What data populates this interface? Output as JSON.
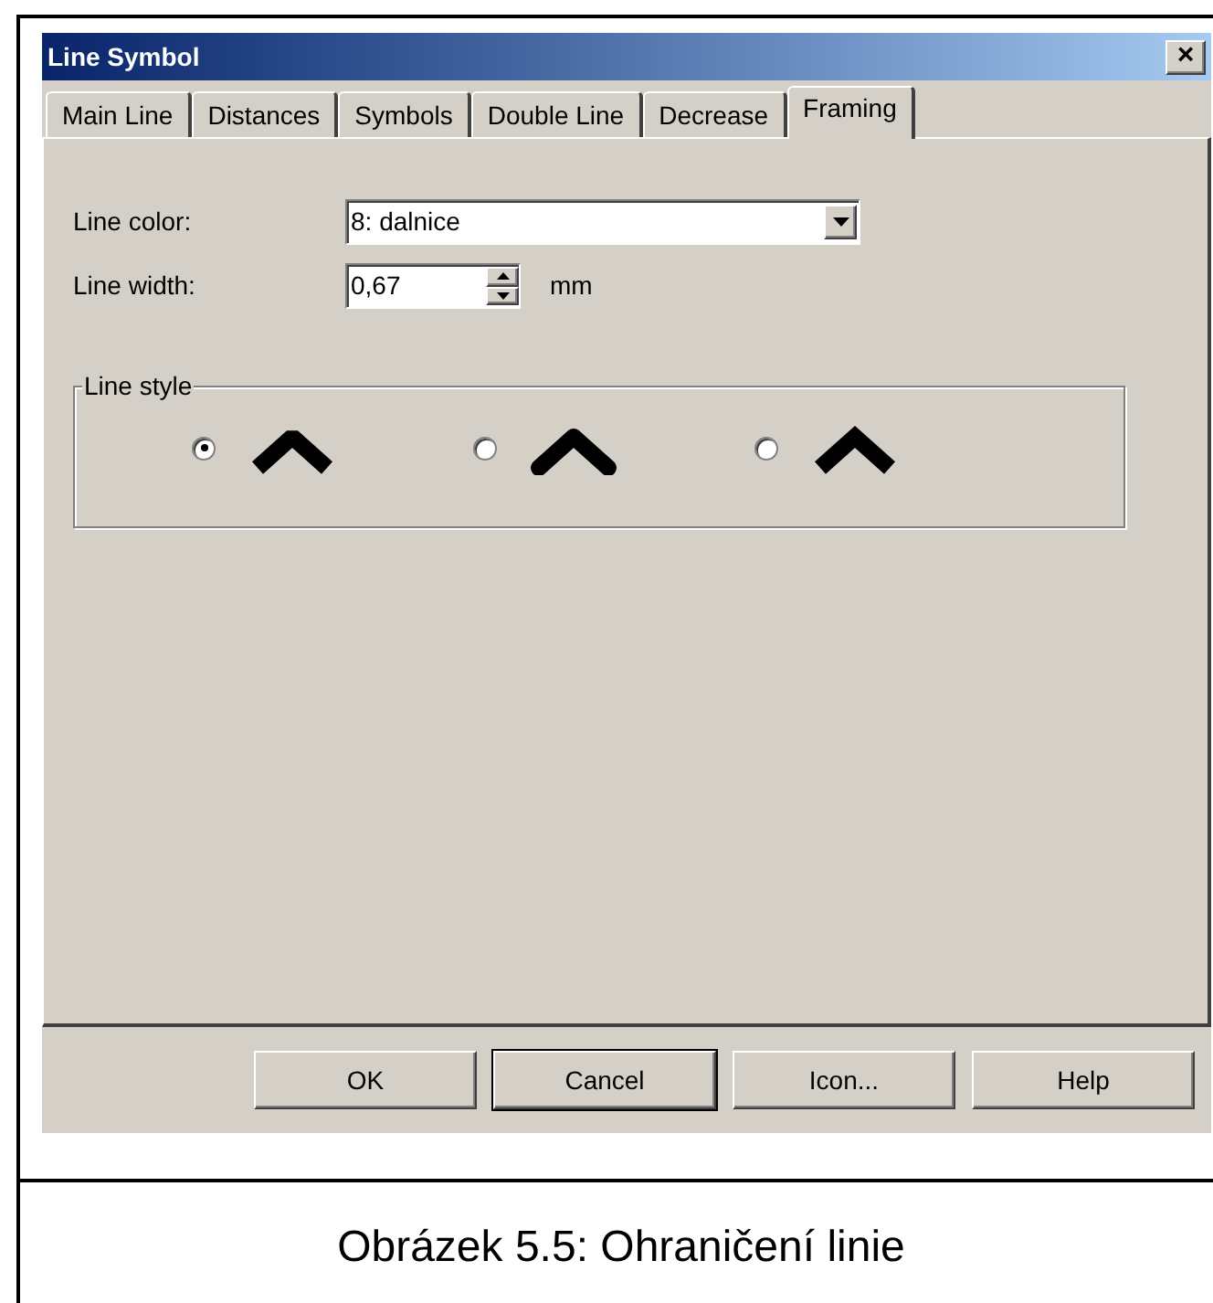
{
  "window": {
    "title": "Line Symbol",
    "close": "×"
  },
  "tabs": [
    {
      "label": "Main Line",
      "selected": false
    },
    {
      "label": "Distances",
      "selected": false
    },
    {
      "label": "Symbols",
      "selected": false
    },
    {
      "label": "Double Line",
      "selected": false
    },
    {
      "label": "Decrease",
      "selected": false
    },
    {
      "label": "Framing",
      "selected": true
    }
  ],
  "line_color": {
    "label": "Line color:",
    "value": "8: dalnice"
  },
  "line_width": {
    "label": "Line width:",
    "value": "0,67",
    "unit": "mm"
  },
  "line_style": {
    "title": "Line style",
    "options": [
      {
        "kind": "bevel",
        "selected": true
      },
      {
        "kind": "round",
        "selected": false
      },
      {
        "kind": "miter",
        "selected": false
      }
    ]
  },
  "buttons": [
    {
      "label": "OK",
      "default": false
    },
    {
      "label": "Cancel",
      "default": true
    },
    {
      "label": "Icon...",
      "default": false
    },
    {
      "label": "Help",
      "default": false
    }
  ],
  "caption": "Obrázek 5.5: Ohraničení linie"
}
